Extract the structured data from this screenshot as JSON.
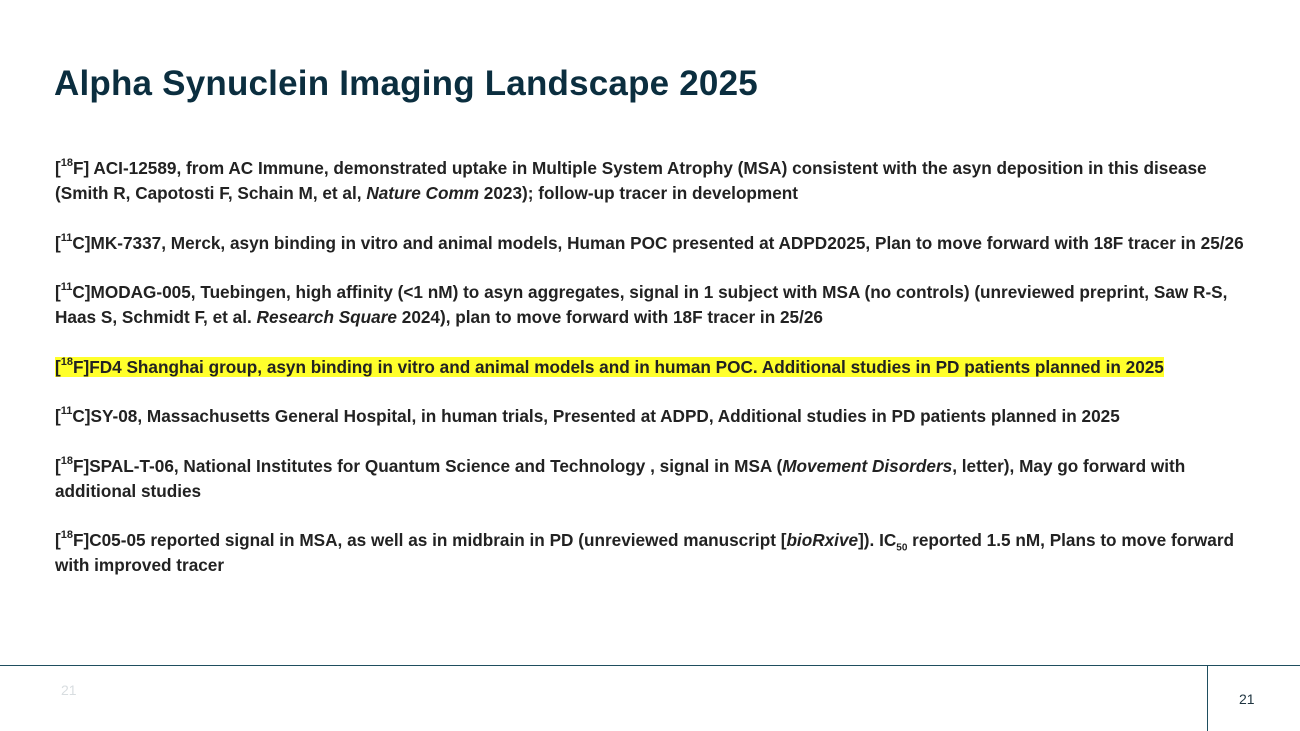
{
  "title": "Alpha Synuclein Imaging Landscape 2025",
  "items": [
    {
      "iso_sup": "18",
      "p1": "F] ACI-12589, from AC Immune, demonstrated uptake in Multiple System Atrophy (MSA) consistent with the asyn deposition in this disease (Smith R, Capotosti F, Schain M, et al, ",
      "em1": "Nature Comm",
      "p2": " 2023); follow-up tracer in development"
    },
    {
      "iso_sup": "11",
      "p1": "C]MK-7337, Merck, asyn binding in vitro and animal models, Human POC presented at ADPD2025, Plan to move forward with 18F tracer in 25/26"
    },
    {
      "iso_sup": "11",
      "p1": "C]MODAG-005, Tuebingen, high affinity (<1 nM) to asyn aggregates, signal in 1 subject with MSA (no controls) (unreviewed preprint, Saw R-S, Haas S, Schmidt F, et al. ",
      "em1": "Research Square",
      "p2": " 2024),  plan to move forward with 18F tracer in 25/26"
    },
    {
      "iso_sup": "18",
      "p1": "F]FD4 Shanghai group, asyn binding in vitro and animal models and in human POC.  Additional studies in PD patients planned in 2025",
      "highlight_color": "#ffff2b"
    },
    {
      "iso_sup": "11",
      "p1": "C]SY-08, Massachusetts General Hospital, in human trials, Presented at ADPD, Additional studies in PD patients planned in 2025"
    },
    {
      "iso_sup": "18",
      "p1": "F]SPAL-T-06, National Institutes for Quantum Science and Technology , signal in MSA (",
      "em1": "Movement Disorders",
      "p2": ", letter), May go forward with additional studies"
    },
    {
      "iso_sup": "18",
      "p1": "F]C05-05 reported signal in MSA, as well as in midbrain in PD (unreviewed manuscript [",
      "em1": "bioRxive",
      "p2": "]).  IC",
      "sub": "50",
      "p3": " reported 1.5 nM, Plans to move forward with improved tracer"
    }
  ],
  "footer": {
    "ghost_page_number": "21",
    "page_number": "21"
  },
  "colors": {
    "title": "#0b2e3f",
    "body_text": "#222222",
    "highlight": "#ffff2b",
    "footer_line": "#1f4e5f"
  }
}
